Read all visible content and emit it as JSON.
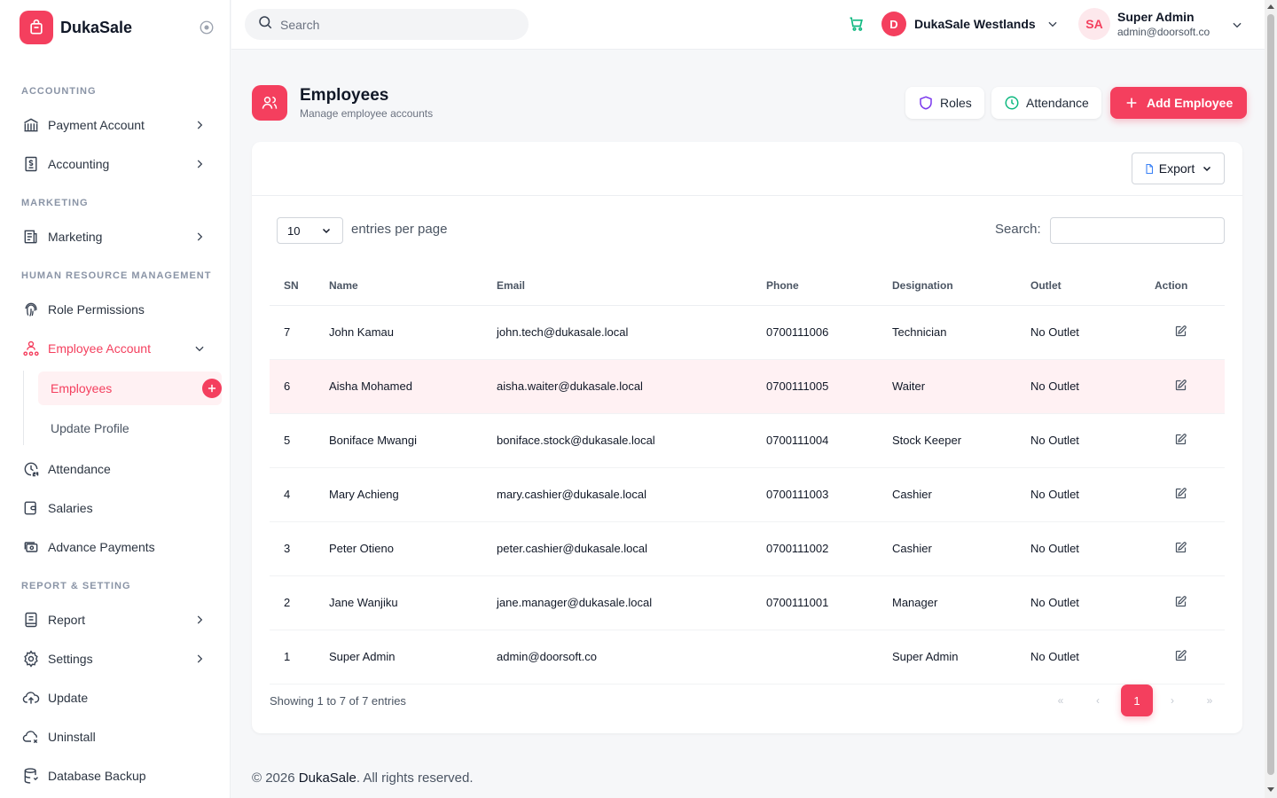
{
  "brand": {
    "name": "DukaSale"
  },
  "sidebar": {
    "sections": {
      "accounting": "ACCOUNTING",
      "marketing": "MARKETING",
      "hrm": "HUMAN RESOURCE MANAGEMENT",
      "report": "REPORT & SETTING"
    },
    "items": {
      "payment_account": "Payment Account",
      "accounting": "Accounting",
      "marketing": "Marketing",
      "role_permissions": "Role Permissions",
      "employee_account": "Employee Account",
      "employees": "Employees",
      "update_profile": "Update Profile",
      "attendance": "Attendance",
      "salaries": "Salaries",
      "advance_payments": "Advance Payments",
      "report": "Report",
      "settings": "Settings",
      "update": "Update",
      "uninstall": "Uninstall",
      "database_backup": "Database Backup"
    }
  },
  "topbar": {
    "search_placeholder": "Search",
    "outlet_initial": "D",
    "outlet_name": "DukaSale Westlands",
    "user_initials": "SA",
    "user_name": "Super Admin",
    "user_email": "admin@doorsoft.co"
  },
  "page": {
    "title": "Employees",
    "subtitle": "Manage employee accounts",
    "buttons": {
      "roles": "Roles",
      "attendance": "Attendance",
      "add": "Add Employee"
    }
  },
  "table": {
    "export_label": "Export",
    "entries_value": "10",
    "entries_label": "entries per page",
    "search_label": "Search:",
    "columns": [
      "SN",
      "Name",
      "Email",
      "Phone",
      "Designation",
      "Outlet",
      "Action"
    ],
    "rows": [
      [
        "7",
        "John Kamau",
        "john.tech@dukasale.local",
        "0700111006",
        "Technician",
        "No Outlet"
      ],
      [
        "6",
        "Aisha Mohamed",
        "aisha.waiter@dukasale.local",
        "0700111005",
        "Waiter",
        "No Outlet"
      ],
      [
        "5",
        "Boniface Mwangi",
        "boniface.stock@dukasale.local",
        "0700111004",
        "Stock Keeper",
        "No Outlet"
      ],
      [
        "4",
        "Mary Achieng",
        "mary.cashier@dukasale.local",
        "0700111003",
        "Cashier",
        "No Outlet"
      ],
      [
        "3",
        "Peter Otieno",
        "peter.cashier@dukasale.local",
        "0700111002",
        "Cashier",
        "No Outlet"
      ],
      [
        "2",
        "Jane Wanjiku",
        "jane.manager@dukasale.local",
        "0700111001",
        "Manager",
        "No Outlet"
      ],
      [
        "1",
        "Super Admin",
        "admin@doorsoft.co",
        "",
        "Super Admin",
        "No Outlet"
      ]
    ],
    "showing": "Showing 1 to 7 of 7 entries",
    "pager": {
      "first": "«",
      "prev": "‹",
      "current": "1",
      "next": "›",
      "last": "»"
    }
  },
  "footer": {
    "prefix": "© 2026 ",
    "brand": "DukaSale",
    "suffix": ". All rights reserved."
  },
  "colors": {
    "accent": "#f43f5e",
    "highlight_row": "#fff1f3",
    "success_icon": "#10b981",
    "purple_icon": "#7c3aed"
  }
}
